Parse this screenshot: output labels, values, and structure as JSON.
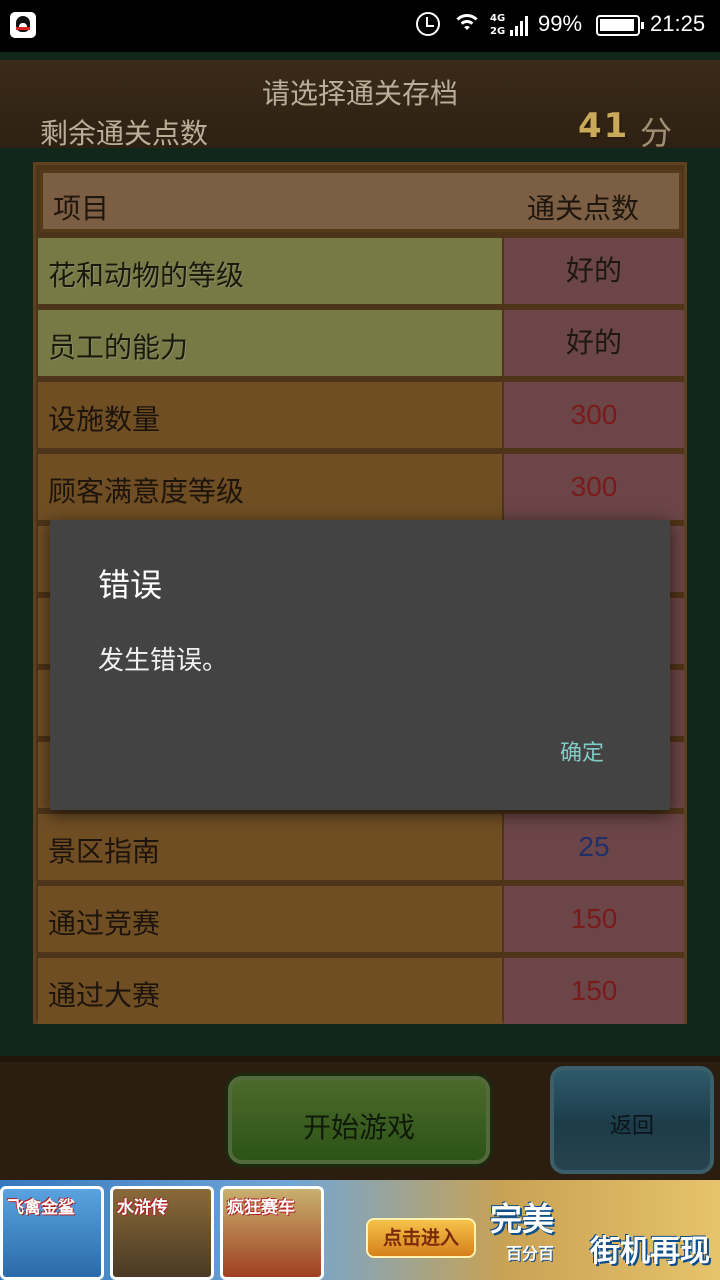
{
  "status_bar": {
    "app_icon": "qq-icon",
    "icons": [
      "alarm-icon",
      "wifi-icon",
      "signal-icon",
      "battery-icon"
    ],
    "network": [
      "4G",
      "2G"
    ],
    "battery": "99%",
    "time": "21:25"
  },
  "header": {
    "title": "请选择通关存档",
    "points_label": "剩余通关点数",
    "points_value": "41",
    "points_unit": "分"
  },
  "table": {
    "columns": [
      "项目",
      "通关点数"
    ],
    "rows": [
      {
        "name": "花和动物的等级",
        "value": "好的",
        "style": "good",
        "highlight": true
      },
      {
        "name": "员工的能力",
        "value": "好的",
        "style": "good",
        "highlight": true
      },
      {
        "name": "设施数量",
        "value": "300",
        "style": "red",
        "highlight": false
      },
      {
        "name": "顾客满意度等级",
        "value": "300",
        "style": "red",
        "highlight": false
      },
      {
        "name": "",
        "value": "",
        "style": "red",
        "highlight": false
      },
      {
        "name": "",
        "value": "",
        "style": "red",
        "highlight": false
      },
      {
        "name": "",
        "value": "",
        "style": "red",
        "highlight": false
      },
      {
        "name": "",
        "value": "",
        "style": "red",
        "highlight": false
      },
      {
        "name": "景区指南",
        "value": "25",
        "style": "blue",
        "highlight": false
      },
      {
        "name": "通过竞赛",
        "value": "150",
        "style": "red",
        "highlight": false
      },
      {
        "name": "通过大赛",
        "value": "150",
        "style": "red",
        "highlight": false
      }
    ]
  },
  "buttons": {
    "start": "开始游戏",
    "back": "返回"
  },
  "ad": {
    "cards": [
      "飞禽金鲨",
      "水浒传",
      "疯狂赛车"
    ],
    "cta": "点击进入",
    "slogan_1": "完美",
    "slogan_2": "百分百",
    "slogan_3": "街机再现"
  },
  "dialog": {
    "title": "错误",
    "message": "发生错误。",
    "ok": "确定"
  },
  "colors": {
    "dialog_bg": "#434343",
    "dialog_button": "#80cbc4",
    "value_red": "#7b1a1a",
    "value_blue": "#1f2f6a"
  }
}
